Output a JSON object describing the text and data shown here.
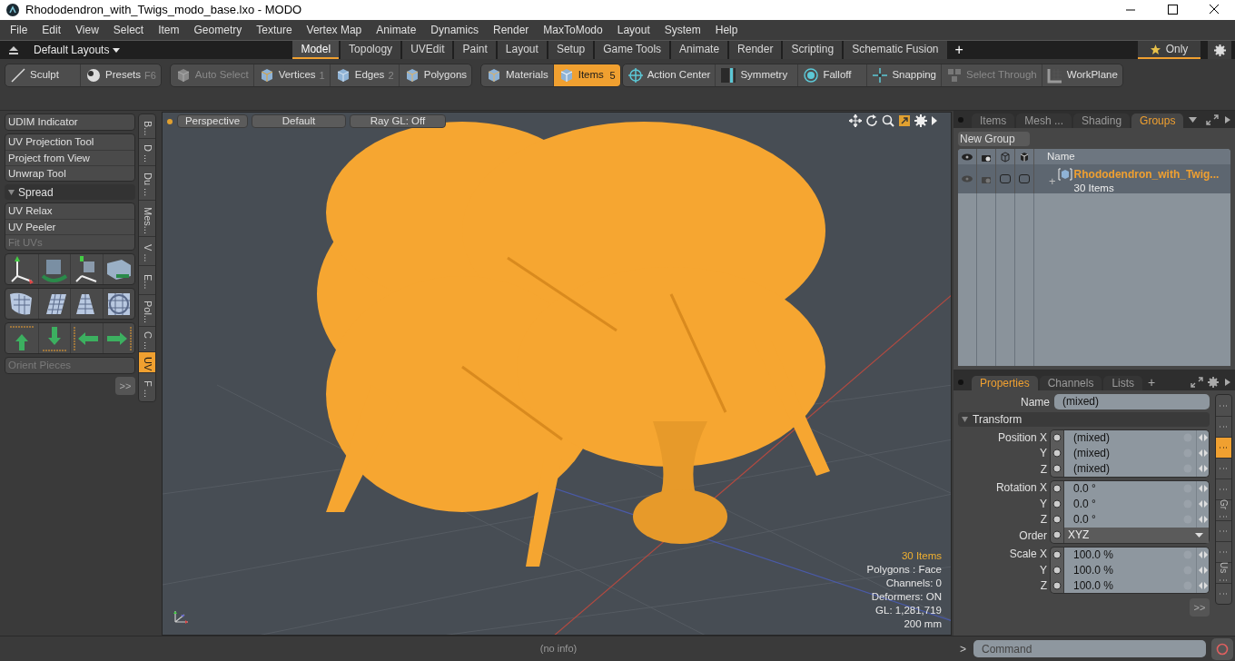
{
  "window": {
    "title": "Rhododendron_with_Twigs_modo_base.lxo - MODO"
  },
  "menu": [
    "File",
    "Edit",
    "View",
    "Select",
    "Item",
    "Geometry",
    "Texture",
    "Vertex Map",
    "Animate",
    "Dynamics",
    "Render",
    "MaxToModo",
    "Layout",
    "System",
    "Help"
  ],
  "layouts": {
    "label": "Default Layouts",
    "tabs": [
      {
        "label": "Model",
        "selected": true
      },
      {
        "label": "Topology",
        "selected": false
      },
      {
        "label": "UVEdit",
        "selected": false
      },
      {
        "label": "Paint",
        "selected": false
      },
      {
        "label": "Layout",
        "selected": false
      },
      {
        "label": "Setup",
        "selected": false
      },
      {
        "label": "Game Tools",
        "selected": false
      },
      {
        "label": "Animate",
        "selected": false
      },
      {
        "label": "Render",
        "selected": false
      },
      {
        "label": "Scripting",
        "selected": false
      },
      {
        "label": "Schematic Fusion",
        "selected": false
      }
    ],
    "add": "+",
    "filter": {
      "label": "Only",
      "on": true
    }
  },
  "toolbar": [
    [
      {
        "label": "Sculpt",
        "disabled": false,
        "selected": false
      },
      {
        "label": "Presets",
        "shortcut": "F6",
        "disabled": false,
        "selected": false
      }
    ],
    [
      {
        "label": "Auto Select",
        "disabled": true,
        "selected": false
      },
      {
        "label": "Vertices",
        "shortcut": "1",
        "disabled": false,
        "selected": false
      },
      {
        "label": "Edges",
        "shortcut": "2",
        "disabled": false,
        "selected": false
      },
      {
        "label": "Polygons",
        "disabled": false,
        "selected": false
      }
    ],
    [
      {
        "label": "Materials",
        "disabled": false,
        "selected": false
      },
      {
        "label": "Items",
        "shortcut": "5",
        "disabled": false,
        "selected": true
      }
    ],
    [
      {
        "label": "Action Center",
        "disabled": false,
        "selected": false
      },
      {
        "label": "Symmetry",
        "disabled": false,
        "selected": false
      },
      {
        "label": "Falloff",
        "disabled": false,
        "selected": false
      },
      {
        "label": "Snapping",
        "disabled": false,
        "selected": false
      },
      {
        "label": "Select Through",
        "disabled": true,
        "selected": false
      },
      {
        "label": "WorkPlane",
        "disabled": false,
        "selected": false
      }
    ]
  ],
  "tool_panel": {
    "items": [
      {
        "kind": "group",
        "buttons": [
          {
            "label": "UDIM Indicator",
            "disabled": false
          }
        ]
      },
      {
        "kind": "group",
        "buttons": [
          {
            "label": "UV Projection Tool",
            "disabled": false
          },
          {
            "label": "Project from View",
            "disabled": false
          },
          {
            "label": "Unwrap Tool",
            "disabled": false
          }
        ]
      },
      {
        "kind": "section",
        "label": "Spread"
      },
      {
        "kind": "group",
        "buttons": [
          {
            "label": "UV Relax",
            "disabled": false
          },
          {
            "label": "UV Peeler",
            "disabled": false
          },
          {
            "label": "Fit UVs",
            "disabled": true
          }
        ]
      },
      {
        "kind": "icons"
      },
      {
        "kind": "group",
        "buttons": [
          {
            "label": "Orient Pieces",
            "disabled": true
          }
        ]
      }
    ],
    "more": ">>",
    "side_tabs": [
      {
        "label": "B...",
        "selected": false
      },
      {
        "label": "D ...",
        "selected": false
      },
      {
        "label": "Du ...",
        "selected": false
      },
      {
        "label": "Mes...",
        "selected": false
      },
      {
        "label": "V ...",
        "selected": false
      },
      {
        "label": "E...",
        "selected": false
      },
      {
        "label": "Pol...",
        "selected": false
      },
      {
        "label": "C ...",
        "selected": false
      },
      {
        "label": "UV",
        "selected": true
      },
      {
        "label": "F ...",
        "selected": false
      }
    ]
  },
  "viewport": {
    "buttons": [
      "Perspective",
      "Default",
      "Ray GL: Off"
    ],
    "info": [
      {
        "text": "30 Items",
        "highlight": true
      },
      {
        "text": "Polygons : Face",
        "highlight": false
      },
      {
        "text": "Channels: 0",
        "highlight": false
      },
      {
        "text": "Deformers: ON",
        "highlight": false
      },
      {
        "text": "GL: 1,281,719",
        "highlight": false
      },
      {
        "text": "200 mm",
        "highlight": false
      }
    ]
  },
  "groups_panel": {
    "tabs": [
      {
        "label": "Items",
        "selected": false
      },
      {
        "label": "Mesh ...",
        "selected": false
      },
      {
        "label": "Shading",
        "selected": false
      },
      {
        "label": "Groups",
        "selected": true
      }
    ],
    "new_button": "New Group",
    "name_column": "Name",
    "rows": [
      {
        "expander": "+",
        "name": "Rhododendron_with_Twig...",
        "count": "30 Items",
        "selected": true
      }
    ]
  },
  "properties_panel": {
    "tabs": [
      {
        "label": "Properties",
        "selected": true
      },
      {
        "label": "Channels",
        "selected": false
      },
      {
        "label": "Lists",
        "selected": false
      }
    ],
    "add": "+",
    "name_label": "Name",
    "name_value": "(mixed)",
    "section": "Transform",
    "blocks": [
      [
        {
          "label": "Position X",
          "value": "(mixed)",
          "kind": "number"
        },
        {
          "label": "Y",
          "value": "(mixed)",
          "kind": "number"
        },
        {
          "label": "Z",
          "value": "(mixed)",
          "kind": "number"
        }
      ],
      [
        {
          "label": "Rotation X",
          "value": "0.0 °",
          "kind": "number"
        },
        {
          "label": "Y",
          "value": "0.0 °",
          "kind": "number"
        },
        {
          "label": "Z",
          "value": "0.0 °",
          "kind": "number"
        },
        {
          "label": "Order",
          "value": "XYZ",
          "kind": "dropdown"
        }
      ],
      [
        {
          "label": "Scale X",
          "value": "100.0 %",
          "kind": "number"
        },
        {
          "label": "Y",
          "value": "100.0 %",
          "kind": "number"
        },
        {
          "label": "Z",
          "value": "100.0 %",
          "kind": "number"
        }
      ]
    ],
    "more": ">>",
    "side_tabs": [
      {
        "label": "⋮",
        "selected": false
      },
      {
        "label": "⋮",
        "selected": false
      },
      {
        "label": "⋮",
        "selected": true
      },
      {
        "label": "⋮",
        "selected": false
      },
      {
        "label": "⋮",
        "selected": false
      },
      {
        "label": "Gr ⋮",
        "selected": false
      },
      {
        "label": "⋮",
        "selected": false
      },
      {
        "label": "⋮",
        "selected": false
      },
      {
        "label": "Us ⋮",
        "selected": false
      },
      {
        "label": "⋮",
        "selected": false
      }
    ]
  },
  "status_bar": {
    "info": "(no info)",
    "prompt": ">",
    "command_placeholder": "Command"
  }
}
